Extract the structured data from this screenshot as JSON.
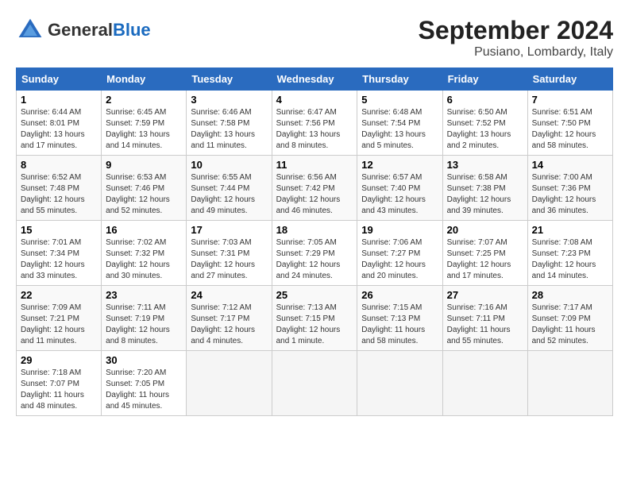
{
  "logo": {
    "general": "General",
    "blue": "Blue"
  },
  "title": "September 2024",
  "location": "Pusiano, Lombardy, Italy",
  "headers": [
    "Sunday",
    "Monday",
    "Tuesday",
    "Wednesday",
    "Thursday",
    "Friday",
    "Saturday"
  ],
  "weeks": [
    [
      {
        "num": "1",
        "info": "Sunrise: 6:44 AM\nSunset: 8:01 PM\nDaylight: 13 hours\nand 17 minutes."
      },
      {
        "num": "2",
        "info": "Sunrise: 6:45 AM\nSunset: 7:59 PM\nDaylight: 13 hours\nand 14 minutes."
      },
      {
        "num": "3",
        "info": "Sunrise: 6:46 AM\nSunset: 7:58 PM\nDaylight: 13 hours\nand 11 minutes."
      },
      {
        "num": "4",
        "info": "Sunrise: 6:47 AM\nSunset: 7:56 PM\nDaylight: 13 hours\nand 8 minutes."
      },
      {
        "num": "5",
        "info": "Sunrise: 6:48 AM\nSunset: 7:54 PM\nDaylight: 13 hours\nand 5 minutes."
      },
      {
        "num": "6",
        "info": "Sunrise: 6:50 AM\nSunset: 7:52 PM\nDaylight: 13 hours\nand 2 minutes."
      },
      {
        "num": "7",
        "info": "Sunrise: 6:51 AM\nSunset: 7:50 PM\nDaylight: 12 hours\nand 58 minutes."
      }
    ],
    [
      {
        "num": "8",
        "info": "Sunrise: 6:52 AM\nSunset: 7:48 PM\nDaylight: 12 hours\nand 55 minutes."
      },
      {
        "num": "9",
        "info": "Sunrise: 6:53 AM\nSunset: 7:46 PM\nDaylight: 12 hours\nand 52 minutes."
      },
      {
        "num": "10",
        "info": "Sunrise: 6:55 AM\nSunset: 7:44 PM\nDaylight: 12 hours\nand 49 minutes."
      },
      {
        "num": "11",
        "info": "Sunrise: 6:56 AM\nSunset: 7:42 PM\nDaylight: 12 hours\nand 46 minutes."
      },
      {
        "num": "12",
        "info": "Sunrise: 6:57 AM\nSunset: 7:40 PM\nDaylight: 12 hours\nand 43 minutes."
      },
      {
        "num": "13",
        "info": "Sunrise: 6:58 AM\nSunset: 7:38 PM\nDaylight: 12 hours\nand 39 minutes."
      },
      {
        "num": "14",
        "info": "Sunrise: 7:00 AM\nSunset: 7:36 PM\nDaylight: 12 hours\nand 36 minutes."
      }
    ],
    [
      {
        "num": "15",
        "info": "Sunrise: 7:01 AM\nSunset: 7:34 PM\nDaylight: 12 hours\nand 33 minutes."
      },
      {
        "num": "16",
        "info": "Sunrise: 7:02 AM\nSunset: 7:32 PM\nDaylight: 12 hours\nand 30 minutes."
      },
      {
        "num": "17",
        "info": "Sunrise: 7:03 AM\nSunset: 7:31 PM\nDaylight: 12 hours\nand 27 minutes."
      },
      {
        "num": "18",
        "info": "Sunrise: 7:05 AM\nSunset: 7:29 PM\nDaylight: 12 hours\nand 24 minutes."
      },
      {
        "num": "19",
        "info": "Sunrise: 7:06 AM\nSunset: 7:27 PM\nDaylight: 12 hours\nand 20 minutes."
      },
      {
        "num": "20",
        "info": "Sunrise: 7:07 AM\nSunset: 7:25 PM\nDaylight: 12 hours\nand 17 minutes."
      },
      {
        "num": "21",
        "info": "Sunrise: 7:08 AM\nSunset: 7:23 PM\nDaylight: 12 hours\nand 14 minutes."
      }
    ],
    [
      {
        "num": "22",
        "info": "Sunrise: 7:09 AM\nSunset: 7:21 PM\nDaylight: 12 hours\nand 11 minutes."
      },
      {
        "num": "23",
        "info": "Sunrise: 7:11 AM\nSunset: 7:19 PM\nDaylight: 12 hours\nand 8 minutes."
      },
      {
        "num": "24",
        "info": "Sunrise: 7:12 AM\nSunset: 7:17 PM\nDaylight: 12 hours\nand 4 minutes."
      },
      {
        "num": "25",
        "info": "Sunrise: 7:13 AM\nSunset: 7:15 PM\nDaylight: 12 hours\nand 1 minute."
      },
      {
        "num": "26",
        "info": "Sunrise: 7:15 AM\nSunset: 7:13 PM\nDaylight: 11 hours\nand 58 minutes."
      },
      {
        "num": "27",
        "info": "Sunrise: 7:16 AM\nSunset: 7:11 PM\nDaylight: 11 hours\nand 55 minutes."
      },
      {
        "num": "28",
        "info": "Sunrise: 7:17 AM\nSunset: 7:09 PM\nDaylight: 11 hours\nand 52 minutes."
      }
    ],
    [
      {
        "num": "29",
        "info": "Sunrise: 7:18 AM\nSunset: 7:07 PM\nDaylight: 11 hours\nand 48 minutes."
      },
      {
        "num": "30",
        "info": "Sunrise: 7:20 AM\nSunset: 7:05 PM\nDaylight: 11 hours\nand 45 minutes."
      },
      {
        "num": "",
        "info": "",
        "empty": true
      },
      {
        "num": "",
        "info": "",
        "empty": true
      },
      {
        "num": "",
        "info": "",
        "empty": true
      },
      {
        "num": "",
        "info": "",
        "empty": true
      },
      {
        "num": "",
        "info": "",
        "empty": true
      }
    ]
  ]
}
